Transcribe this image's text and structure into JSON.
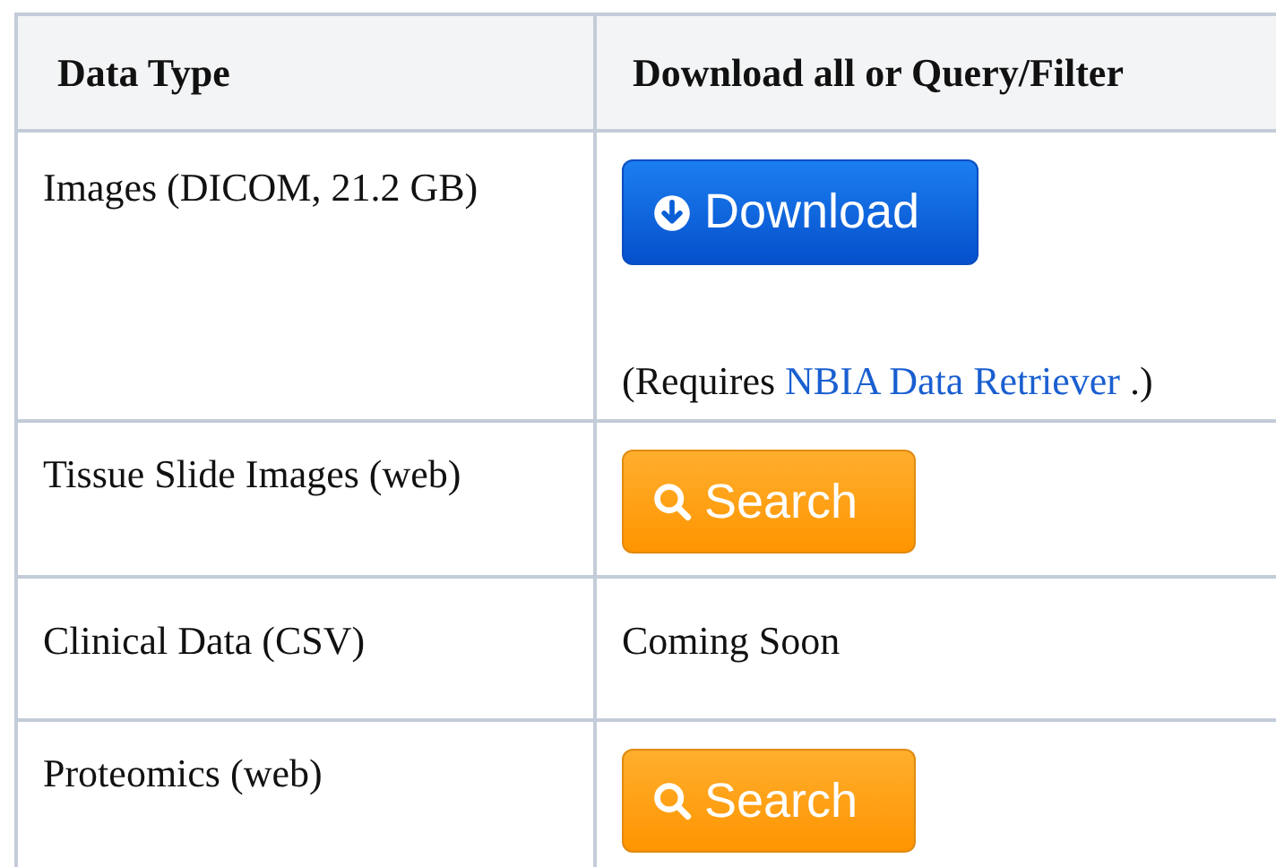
{
  "table": {
    "columns": [
      "Data Type",
      "Download all or Query/Filter"
    ],
    "rows": [
      {
        "data_type": "Images (DICOM, 21.2 GB)",
        "action": {
          "kind": "download",
          "label": "Download"
        },
        "note": {
          "before": "(Requires ",
          "link": "NBIA Data Retriever",
          "after": " .)"
        }
      },
      {
        "data_type": "Tissue Slide Images (web)",
        "action": {
          "kind": "search",
          "label": "Search"
        }
      },
      {
        "data_type": "Clinical Data (CSV)",
        "action": {
          "kind": "text",
          "label": "Coming Soon"
        }
      },
      {
        "data_type": "Proteomics (web)",
        "action": {
          "kind": "search",
          "label": "Search"
        }
      }
    ]
  }
}
